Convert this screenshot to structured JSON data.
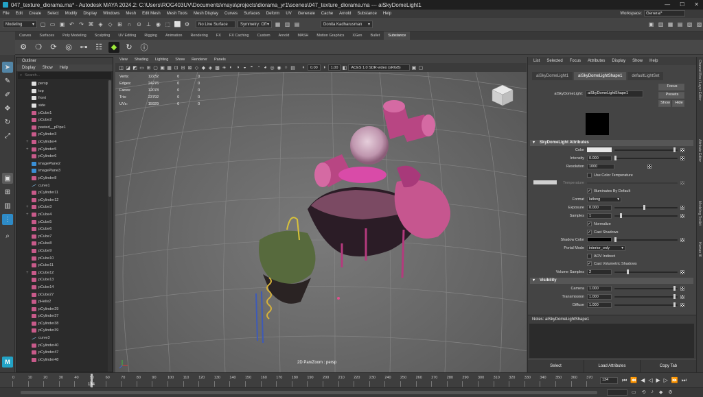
{
  "title_bar": {
    "text": "047_texture_diorama.ma* - Autodesk MAYA 2024.2: C:\\Users\\ROG403UV\\Documents\\maya\\projects\\diorama_yr1\\scenes\\047_texture_diorama.ma --- aiSkyDomeLight1",
    "minimize": "—",
    "maximize": "☐",
    "close": "✕"
  },
  "menu_bar": {
    "items": [
      "File",
      "Edit",
      "Create",
      "Select",
      "Modify",
      "Display",
      "Windows",
      "Mesh",
      "Edit Mesh",
      "Mesh Tools",
      "Mesh Display",
      "Curves",
      "Surfaces",
      "Deform",
      "UV",
      "Generate",
      "Cache",
      "Arnold",
      "Substance",
      "Help"
    ],
    "workspace_label": "Workspace:",
    "workspace_value": "General*"
  },
  "status_line": {
    "mode": "Modeling",
    "live_surface": "No Live Surface",
    "symmetry": "Symmetry: Off",
    "user": "Donita Kadharusman"
  },
  "shelf_tabs": {
    "items": [
      "Curves",
      "Surfaces",
      "Poly Modeling",
      "Sculpting",
      "UV Editing",
      "Rigging",
      "Animation",
      "Rendering",
      "FX",
      "FX Caching",
      "Custom",
      "Arnold",
      "MASH",
      "Motion Graphics",
      "XGen",
      "Bullet",
      "Substance"
    ],
    "active": "Substance"
  },
  "outliner": {
    "title": "Outliner",
    "menu": [
      "Display",
      "Show",
      "Help"
    ],
    "search_placeholder": "Search...",
    "items": [
      {
        "name": "persp",
        "type": "camera",
        "exp": ""
      },
      {
        "name": "top",
        "type": "camera",
        "exp": ""
      },
      {
        "name": "front",
        "type": "camera",
        "exp": ""
      },
      {
        "name": "side",
        "type": "camera",
        "exp": ""
      },
      {
        "name": "pCube1",
        "type": "mesh",
        "exp": ""
      },
      {
        "name": "pCube2",
        "type": "mesh",
        "exp": ""
      },
      {
        "name": "pasted__pPipe1",
        "type": "mesh",
        "exp": ""
      },
      {
        "name": "pCylinder3",
        "type": "mesh",
        "exp": ""
      },
      {
        "name": "pCylinder4",
        "type": "mesh",
        "exp": "+"
      },
      {
        "name": "pCylinder5",
        "type": "mesh",
        "exp": "+"
      },
      {
        "name": "pCylinder6",
        "type": "mesh",
        "exp": ""
      },
      {
        "name": "imagePlane2",
        "type": "image",
        "exp": ""
      },
      {
        "name": "imagePlane3",
        "type": "image",
        "exp": ""
      },
      {
        "name": "pCylinder8",
        "type": "mesh",
        "exp": ""
      },
      {
        "name": "curve1",
        "type": "curve",
        "exp": ""
      },
      {
        "name": "pCylinder11",
        "type": "mesh",
        "exp": ""
      },
      {
        "name": "pCylinder12",
        "type": "mesh",
        "exp": ""
      },
      {
        "name": "pCube3",
        "type": "mesh",
        "exp": "+"
      },
      {
        "name": "pCube4",
        "type": "mesh",
        "exp": "+"
      },
      {
        "name": "pCube5",
        "type": "mesh",
        "exp": ""
      },
      {
        "name": "pCube6",
        "type": "mesh",
        "exp": ""
      },
      {
        "name": "pCube7",
        "type": "mesh",
        "exp": ""
      },
      {
        "name": "pCube8",
        "type": "mesh",
        "exp": ""
      },
      {
        "name": "pCube9",
        "type": "mesh",
        "exp": ""
      },
      {
        "name": "pCube10",
        "type": "mesh",
        "exp": ""
      },
      {
        "name": "pCube11",
        "type": "mesh",
        "exp": ""
      },
      {
        "name": "pCube12",
        "type": "mesh",
        "exp": "+"
      },
      {
        "name": "pCube13",
        "type": "mesh",
        "exp": ""
      },
      {
        "name": "pCube14",
        "type": "mesh",
        "exp": ""
      },
      {
        "name": "pCube27",
        "type": "mesh",
        "exp": ""
      },
      {
        "name": "pHelix2",
        "type": "mesh",
        "exp": ""
      },
      {
        "name": "pCylinder29",
        "type": "mesh",
        "exp": ""
      },
      {
        "name": "pCylinder37",
        "type": "mesh",
        "exp": ""
      },
      {
        "name": "pCylinder38",
        "type": "mesh",
        "exp": ""
      },
      {
        "name": "pCylinder39",
        "type": "mesh",
        "exp": ""
      },
      {
        "name": "curve3",
        "type": "curve",
        "exp": ""
      },
      {
        "name": "pCylinder40",
        "type": "mesh",
        "exp": ""
      },
      {
        "name": "pCylinder47",
        "type": "mesh",
        "exp": ""
      },
      {
        "name": "pCylinder48",
        "type": "mesh",
        "exp": ""
      }
    ]
  },
  "viewport": {
    "menu": [
      "View",
      "Shading",
      "Lighting",
      "Show",
      "Renderer",
      "Panels"
    ],
    "exposure": "0.00",
    "gamma": "1.00",
    "color_space": "ACES 1.0 SDR-video (sRGB)",
    "hud": [
      {
        "label": "Verts:",
        "value": "12232",
        "sel": "0",
        "extra": "0"
      },
      {
        "label": "Edges:",
        "value": "24276",
        "sel": "0",
        "extra": "0"
      },
      {
        "label": "Faces:",
        "value": "12078",
        "sel": "0",
        "extra": "0"
      },
      {
        "label": "Tris:",
        "value": "23792",
        "sel": "0",
        "extra": "0"
      },
      {
        "label": "UVs:",
        "value": "15929",
        "sel": "0",
        "extra": "0"
      }
    ],
    "camera_label": "2D Pan/Zoom : persp"
  },
  "attribute_editor": {
    "menu": [
      "List",
      "Selected",
      "Focus",
      "Attributes",
      "Display",
      "Show",
      "Help"
    ],
    "tabs": [
      "aiSkyDomeLight1",
      "aiSkyDomeLightShape1",
      "defaultLightSet"
    ],
    "active_tab": "aiSkyDomeLightShape1",
    "node_label": "aiSkyDomeLight:",
    "node_name": "aiSkyDomeLightShape1",
    "focus_btn": "Focus",
    "presets_btn": "Presets",
    "show_btn": "Show",
    "hide_btn": "Hide",
    "section1": "SkyDomeLight Attributes",
    "color_label": "Color",
    "intensity_label": "Intensity",
    "intensity_value": "0.000",
    "resolution_label": "Resolution",
    "resolution_value": "1000",
    "use_color_temp": "Use Color Temperature",
    "temperature_label": "Temperature",
    "illuminates": "Illuminates By Default",
    "format_label": "Format",
    "format_value": "latlong",
    "exposure_label": "Exposure",
    "exposure_value": "0.000",
    "samples_label": "Samples",
    "samples_value": "1",
    "normalize": "Normalize",
    "cast_shadows": "Cast Shadows",
    "shadow_color_label": "Shadow Color",
    "portal_mode_label": "Portal Mode",
    "portal_mode_value": "interior_only",
    "aov_indirect": "AOV Indirect",
    "cast_vol_shadows": "Cast Volumetric Shadows",
    "volume_samples_label": "Volume Samples",
    "volume_samples_value": "2",
    "section2": "Visibility",
    "camera_label": "Camera",
    "camera_value": "1.000",
    "transmission_label": "Transmission",
    "transmission_value": "1.000",
    "diffuse_label": "Diffuse",
    "diffuse_value": "1.000",
    "notes_label": "Notes: aiSkyDomeLightShape1",
    "bottom_buttons": [
      "Select",
      "Load Attributes",
      "Copy Tab"
    ]
  },
  "right_tabs": [
    "Channel Box / Layer Editor",
    "Attribute Editor",
    "Modeling Toolkit",
    "Human IK"
  ],
  "time_slider": {
    "ticks": [
      "0",
      "10",
      "20",
      "30",
      "40",
      "50",
      "60",
      "70",
      "80",
      "90",
      "100",
      "110",
      "120",
      "130",
      "140",
      "150",
      "160",
      "170",
      "180",
      "190",
      "200",
      "210",
      "220",
      "230",
      "240",
      "250",
      "260",
      "270",
      "280",
      "290",
      "300",
      "310",
      "320",
      "330",
      "340",
      "350",
      "360",
      "370"
    ],
    "current_frame": "134",
    "frame_field": "134"
  },
  "colors": {
    "accent": "#5285a6",
    "pink": "#c24a8e",
    "highlight": "#2e8bc7"
  }
}
